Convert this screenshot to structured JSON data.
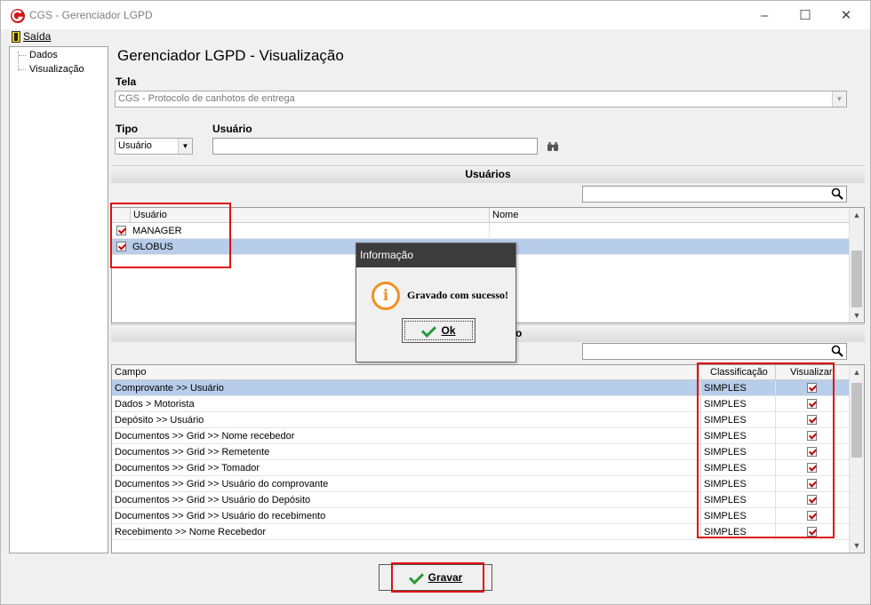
{
  "window": {
    "title": "CGS - Gerenciador LGPD"
  },
  "menu": {
    "exit_label": "Saída"
  },
  "nav_tree": {
    "items": [
      "Dados",
      "Visualização"
    ]
  },
  "page": {
    "title": "Gerenciador LGPD - Visualização"
  },
  "form": {
    "screen_label": "Tela",
    "screen_value": "CGS - Protocolo de canhotos de entrega",
    "type_label": "Tipo",
    "type_value": "Usuário",
    "user_label": "Usuário",
    "user_value": ""
  },
  "users_section": {
    "title": "Usuários",
    "search_value": "",
    "columns": [
      "Usuário",
      "Nome"
    ],
    "rows": [
      {
        "checked": true,
        "user": "MANAGER",
        "name": "",
        "selected": false
      },
      {
        "checked": true,
        "user": "GLOBUS",
        "name": "",
        "selected": true
      }
    ]
  },
  "fields_section": {
    "title_visible": "o",
    "search_value": "",
    "columns": [
      "Campo",
      "Classificação",
      "Visualizar"
    ],
    "rows": [
      {
        "field": "Comprovante >> Usuário",
        "class": "SIMPLES",
        "view": true,
        "selected": true
      },
      {
        "field": "Dados > Motorista",
        "class": "SIMPLES",
        "view": true,
        "selected": false
      },
      {
        "field": "Depósito >> Usuário",
        "class": "SIMPLES",
        "view": true,
        "selected": false
      },
      {
        "field": "Documentos >> Grid >> Nome recebedor",
        "class": "SIMPLES",
        "view": true,
        "selected": false
      },
      {
        "field": "Documentos >> Grid >> Remetente",
        "class": "SIMPLES",
        "view": true,
        "selected": false
      },
      {
        "field": "Documentos >> Grid >> Tomador",
        "class": "SIMPLES",
        "view": true,
        "selected": false
      },
      {
        "field": "Documentos >> Grid >> Usuário do comprovante",
        "class": "SIMPLES",
        "view": true,
        "selected": false
      },
      {
        "field": "Documentos >> Grid >> Usuário do Depósito",
        "class": "SIMPLES",
        "view": true,
        "selected": false
      },
      {
        "field": "Documentos >> Grid >> Usuário do recebimento",
        "class": "SIMPLES",
        "view": true,
        "selected": false
      },
      {
        "field": "Recebimento >> Nome Recebedor",
        "class": "SIMPLES",
        "view": true,
        "selected": false
      }
    ]
  },
  "dialog": {
    "title": "Informação",
    "message": "Gravado com sucesso!",
    "ok_label": "Ok"
  },
  "footer": {
    "save_label": "Gravar"
  },
  "colors": {
    "accent_red": "#e01010",
    "selection": "#b8cdea",
    "check_green": "#2a9a3a",
    "info_orange": "#f09020"
  }
}
